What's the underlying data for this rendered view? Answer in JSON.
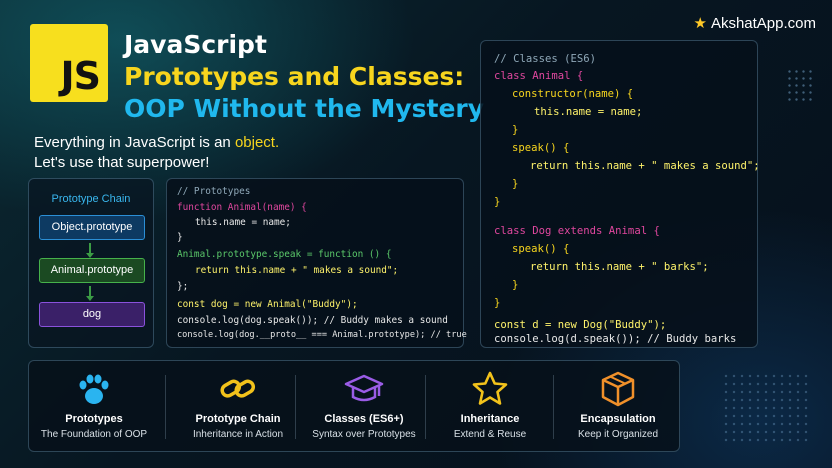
{
  "header": {
    "logo_text": "JS",
    "title_line1": "JavaScript",
    "title_line2": "Prototypes and Classes:",
    "title_line3": "OOP Without the Mystery",
    "subtitle_line1_prefix": "Everything in JavaScript is an ",
    "subtitle_line1_highlight": "object.",
    "subtitle_line2": "Let's use that superpower!",
    "brand": "AkshatApp.com",
    "brand_icon": "star-icon",
    "colors": {
      "logo_bg": "#f7df1e",
      "title_yellow": "#f7d51e",
      "title_blue": "#20b8ee"
    }
  },
  "chain": {
    "title": "Prototype Chain",
    "boxes": [
      "Object.prototype",
      "Animal.prototype",
      "dog"
    ],
    "colors": [
      "#2b8fd6",
      "#46b24b",
      "#8a52dc"
    ]
  },
  "code_prototypes": {
    "comment": "// Prototypes",
    "lines": [
      "function Animal(name) {",
      "this.name = name;",
      "}",
      "Animal.prototype.speak = function () {",
      "return this.name + \" makes a sound\";",
      "};",
      "const dog = new Animal(\"Buddy\");",
      "console.log(dog.speak()); // Buddy makes a sound",
      "console.log(dog.__proto__ === Animal.prototype); // true"
    ]
  },
  "code_classes": {
    "comment": "// Classes (ES6)",
    "lines": [
      "class Animal {",
      "constructor(name) {",
      "this.name = name;",
      "}",
      "speak() {",
      "return this.name + \" makes a sound\";",
      "}",
      "}",
      "class Dog extends Animal {",
      "speak() {",
      "return this.name + \" barks\";",
      "}",
      "}",
      "const d = new Dog(\"Buddy\");",
      "console.log(d.speak()); // Buddy barks"
    ]
  },
  "features": [
    {
      "name": "Prototypes",
      "desc": "The Foundation of OOP",
      "icon": "paw-icon",
      "color": "#2ab4f0"
    },
    {
      "name": "Prototype Chain",
      "desc": "Inheritance in Action",
      "icon": "chain-link-icon",
      "color": "#f2c21b"
    },
    {
      "name": "Classes (ES6+)",
      "desc": "Syntax over Prototypes",
      "icon": "graduation-cap-icon",
      "color": "#9a5ce6"
    },
    {
      "name": "Inheritance",
      "desc": "Extend & Reuse",
      "icon": "star-outline-icon",
      "color": "#f2c21b"
    },
    {
      "name": "Encapsulation",
      "desc": "Keep it Organized",
      "icon": "box-icon",
      "color": "#f0902a"
    }
  ]
}
